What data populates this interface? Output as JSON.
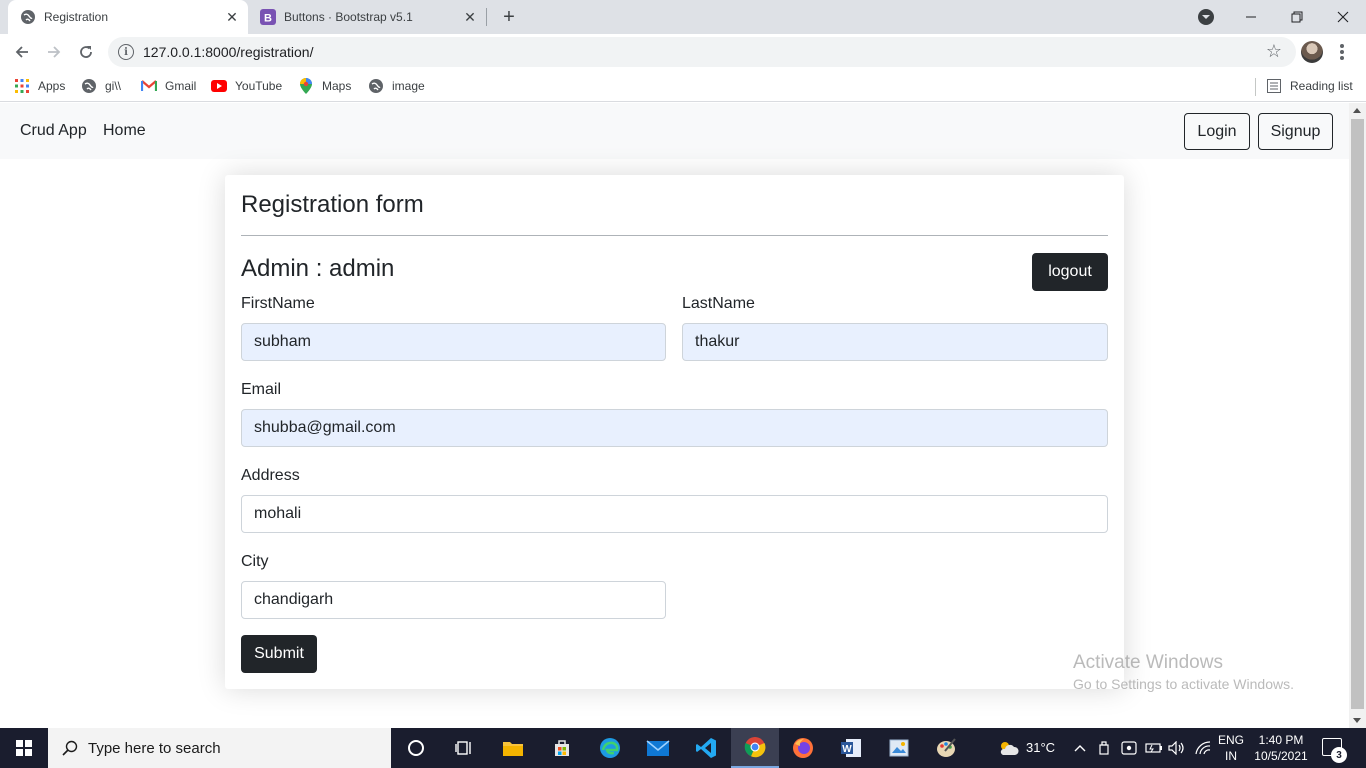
{
  "browser": {
    "tabs": [
      {
        "title": "Registration",
        "active": true,
        "icon": "globe-icon"
      },
      {
        "title": "Buttons · Bootstrap v5.1",
        "active": false,
        "icon": "bootstrap-icon"
      }
    ],
    "url": "127.0.0.1:8000/registration/",
    "bookmarks": [
      {
        "label": "Apps",
        "icon": "apps-grid-icon"
      },
      {
        "label": "gi\\\\",
        "icon": "globe-icon"
      },
      {
        "label": "Gmail",
        "icon": "gmail-icon"
      },
      {
        "label": "YouTube",
        "icon": "youtube-icon"
      },
      {
        "label": "Maps",
        "icon": "maps-pin-icon"
      },
      {
        "label": "image",
        "icon": "globe-icon"
      }
    ],
    "reading_list": "Reading list"
  },
  "navbar": {
    "brand": "Crud App",
    "home": "Home",
    "login": "Login",
    "signup": "Signup"
  },
  "form": {
    "title": "Registration form",
    "admin_heading": "Admin : admin",
    "logout": "logout",
    "fields": {
      "firstname": {
        "label": "FirstName",
        "value": "subham"
      },
      "lastname": {
        "label": "LastName",
        "value": "thakur"
      },
      "email": {
        "label": "Email",
        "value": "shubba@gmail.com"
      },
      "address": {
        "label": "Address",
        "value": "mohali"
      },
      "city": {
        "label": "City",
        "value": "chandigarh"
      }
    },
    "submit": "Submit"
  },
  "watermark": {
    "line1": "Activate Windows",
    "line2": "Go to Settings to activate Windows."
  },
  "taskbar": {
    "search_placeholder": "Type here to search",
    "weather": "31°C",
    "lang_line1": "ENG",
    "lang_line2": "IN",
    "time": "1:40 PM",
    "date": "10/5/2021",
    "notification_count": "3"
  },
  "colors": {
    "dark_button": "#212529",
    "autofill_bg": "#e8f0fe",
    "navbar_bg": "#f8f9fa",
    "taskbar_bg": "#1a1d2e"
  }
}
